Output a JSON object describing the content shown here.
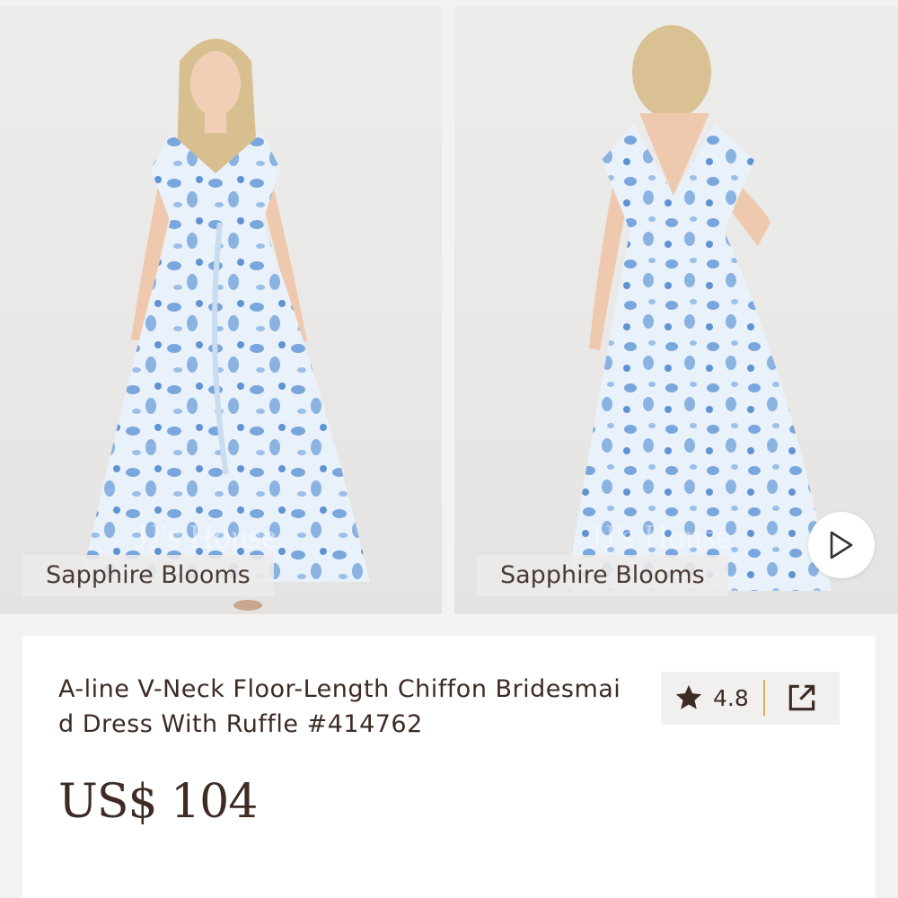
{
  "gallery": {
    "images": [
      {
        "color_label": "Sapphire Blooms",
        "view": "front"
      },
      {
        "color_label": "Sapphire Blooms",
        "view": "back"
      }
    ],
    "watermark": "JJ's House"
  },
  "product": {
    "title": "A-line V-Neck Floor-Length Chiffon Bridesmaid Dress With Ruffle #414762",
    "rating": "4.8",
    "price": "US$ 104"
  },
  "colors": {
    "text": "#3d2b24",
    "accent_divider": "#d9b15a",
    "dress_base": "#e8f1fa",
    "dress_print": "#6f9fd6"
  },
  "icons": [
    "star-icon",
    "share-icon",
    "play-icon"
  ]
}
